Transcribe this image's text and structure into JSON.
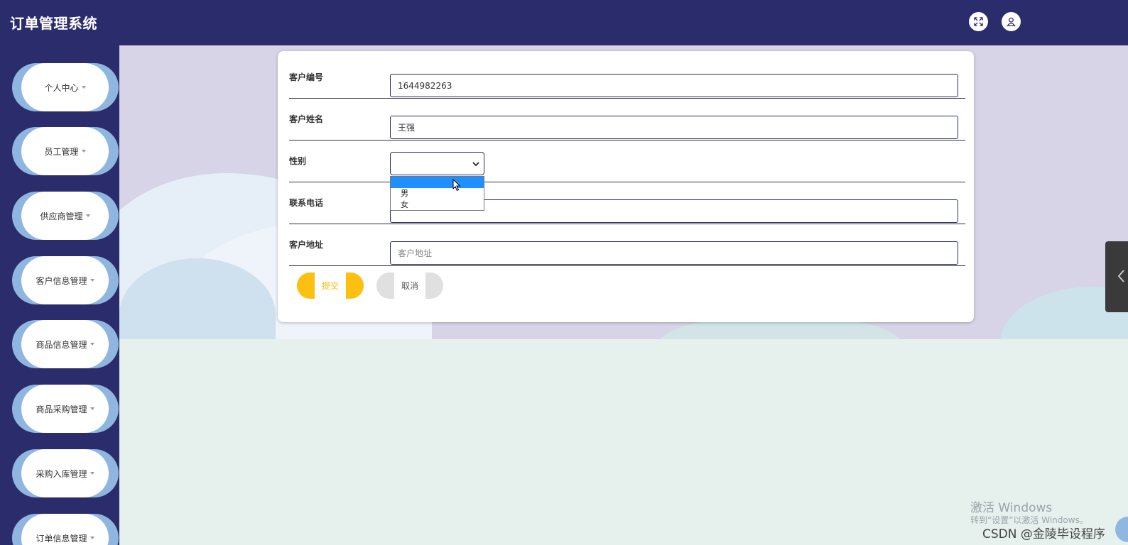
{
  "header": {
    "title": "订单管理系统",
    "fullscreen_icon": "fullscreen-icon",
    "user_icon": "user-icon"
  },
  "sidebar": {
    "items": [
      {
        "label": "个人中心"
      },
      {
        "label": "员工管理"
      },
      {
        "label": "供应商管理"
      },
      {
        "label": "客户信息管理"
      },
      {
        "label": "商品信息管理"
      },
      {
        "label": "商品采购管理"
      },
      {
        "label": "采购入库管理"
      },
      {
        "label": "订单信息管理"
      }
    ]
  },
  "form": {
    "fields": [
      {
        "label": "客户编号",
        "value": "1644982263"
      },
      {
        "label": "客户姓名",
        "value": "王强"
      },
      {
        "label": "性别",
        "value": ""
      },
      {
        "label": "联系电话",
        "value": ""
      },
      {
        "label": "客户地址",
        "value": "",
        "placeholder": "客户地址"
      }
    ],
    "gender_options": [
      "",
      "男",
      "女"
    ],
    "submit_label": "提交",
    "cancel_label": "取消"
  },
  "watermark": {
    "line1": "激活 Windows",
    "line2": "转到“设置”以激活 Windows。",
    "csdn": "CSDN @金陵毕设程序"
  },
  "colors": {
    "header_bg": "#2b2c6c",
    "sidebar_accent": "#8fb6de",
    "submit_bg": "#fcc010",
    "select_highlight": "#1e90ff"
  }
}
